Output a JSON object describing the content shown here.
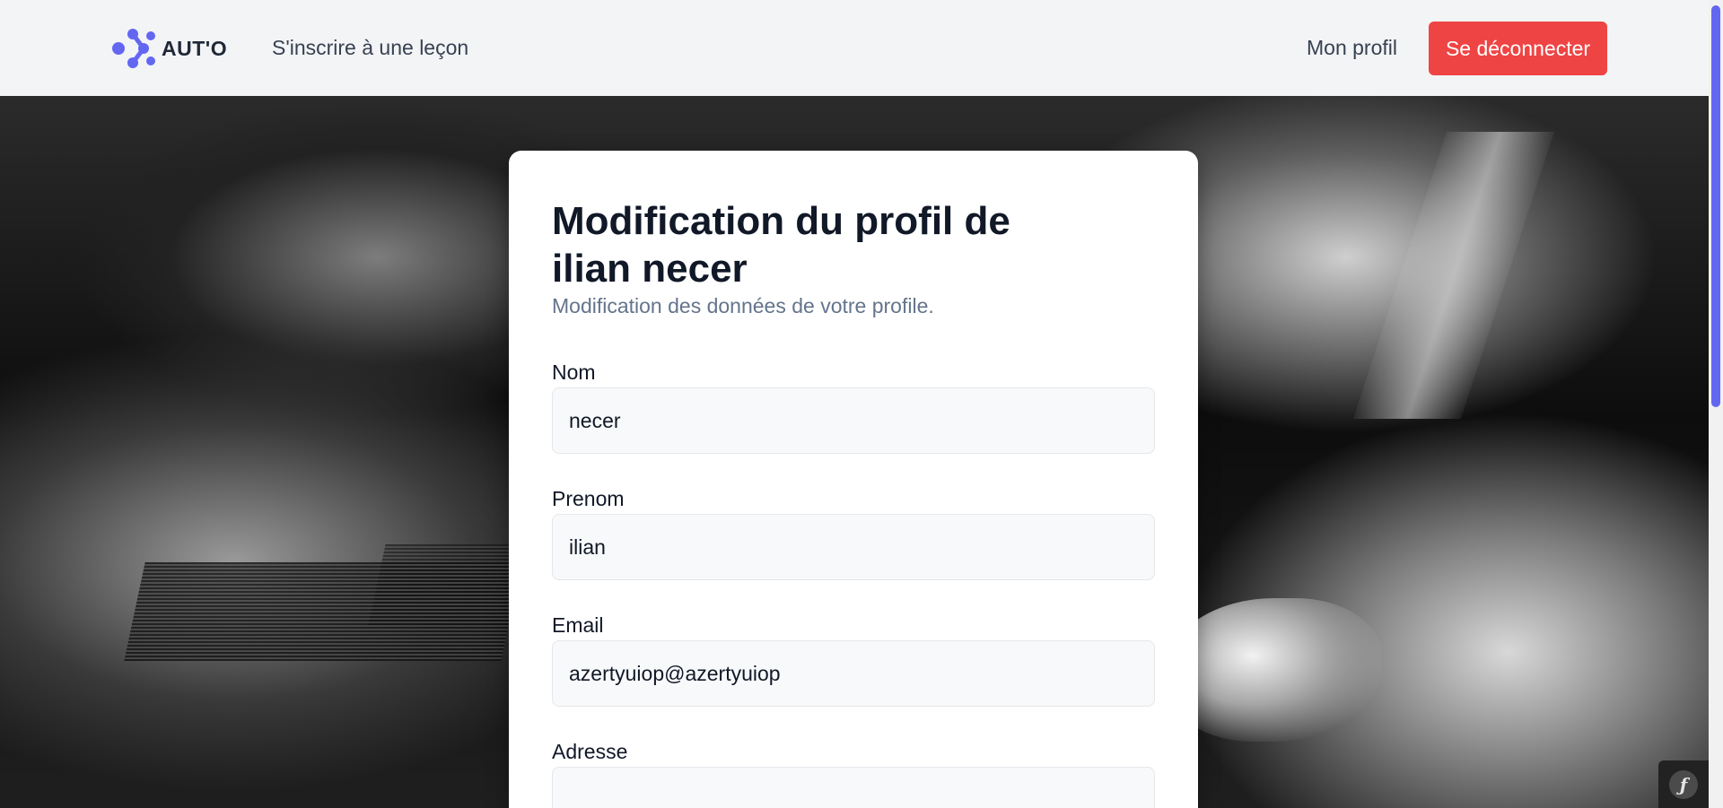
{
  "navbar": {
    "brand_name": "AUT'O",
    "links": {
      "lesson": "S'inscrire à une leçon",
      "profile": "Mon profil"
    },
    "logout_label": "Se déconnecter"
  },
  "card": {
    "title": "Modification du profil de ilian necer",
    "subtitle": "Modification des données de votre profile.",
    "fields": {
      "nom": {
        "label": "Nom",
        "value": "necer"
      },
      "prenom": {
        "label": "Prenom",
        "value": "ilian"
      },
      "email": {
        "label": "Email",
        "value": "azertyuiop@azertyuiop"
      },
      "adresse": {
        "label": "Adresse",
        "value": ""
      }
    }
  },
  "icons": {
    "brand": "molecule-logo-icon",
    "debug": "symfony-icon"
  },
  "colors": {
    "accent": "#6366f1",
    "logout": "#ef4444",
    "navbar_bg": "#f3f4f6",
    "subtitle": "#64748b"
  }
}
